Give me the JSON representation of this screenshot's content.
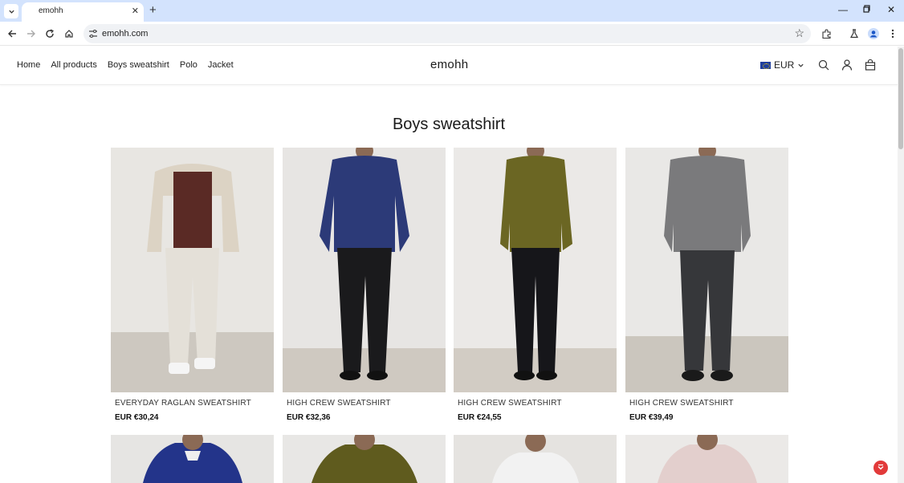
{
  "browser": {
    "tab_title": "emohh",
    "url": "emohh.com"
  },
  "site": {
    "brand": "emohh",
    "menu": [
      "Home",
      "All products",
      "Boys sweatshirt",
      "Polo",
      "Jacket"
    ],
    "currency": "EUR"
  },
  "collection": {
    "title": "Boys sweatshirt",
    "products": [
      {
        "name": "EVERYDAY RAGLAN SWEATSHIRT",
        "price": "EUR €30,24"
      },
      {
        "name": "HIGH CREW SWEATSHIRT",
        "price": "EUR €32,36"
      },
      {
        "name": "HIGH CREW SWEATSHIRT",
        "price": "EUR €24,55"
      },
      {
        "name": "HIGH CREW SWEATSHIRT",
        "price": "EUR €39,49"
      }
    ]
  },
  "colors": {
    "tabbar": "#d3e3fd",
    "chat_button": "#e23a3a",
    "product_top_1": "#5a2a25",
    "product_top_2": "#2c3a78",
    "product_top_3": "#6b6623",
    "product_top_4": "#7a7a7c",
    "product_row2_1": "#23348a",
    "product_row2_2": "#5f5b1e",
    "product_row2_3": "#f2f2f2",
    "product_row2_4": "#e3cfcd"
  }
}
